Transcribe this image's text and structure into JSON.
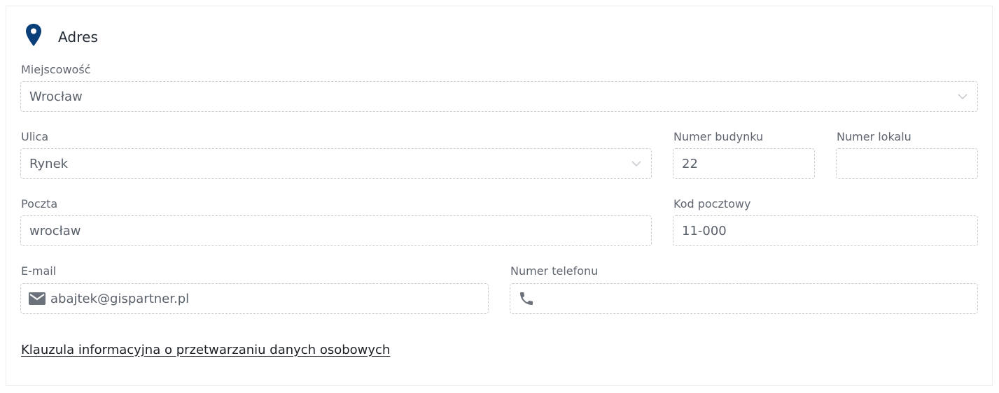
{
  "section": {
    "title": "Adres",
    "icon": "map-pin-icon",
    "accent_color": "#0b3f7a"
  },
  "fields": {
    "city": {
      "label": "Miejscowość",
      "value": "Wrocław"
    },
    "street": {
      "label": "Ulica",
      "value": "Rynek"
    },
    "building_number": {
      "label": "Numer budynku",
      "value": "22"
    },
    "apartment_number": {
      "label": "Numer lokalu",
      "value": ""
    },
    "post_office": {
      "label": "Poczta",
      "value": "wrocław"
    },
    "postal_code": {
      "label": "Kod pocztowy",
      "value": "11-000"
    },
    "email": {
      "label": "E-mail",
      "value": "abajtek@gispartner.pl",
      "icon": "envelope-icon"
    },
    "phone": {
      "label": "Numer telefonu",
      "value": "",
      "icon": "phone-icon"
    }
  },
  "privacy_link": "Klauzula informacyjna o przetwarzaniu danych osobowych"
}
